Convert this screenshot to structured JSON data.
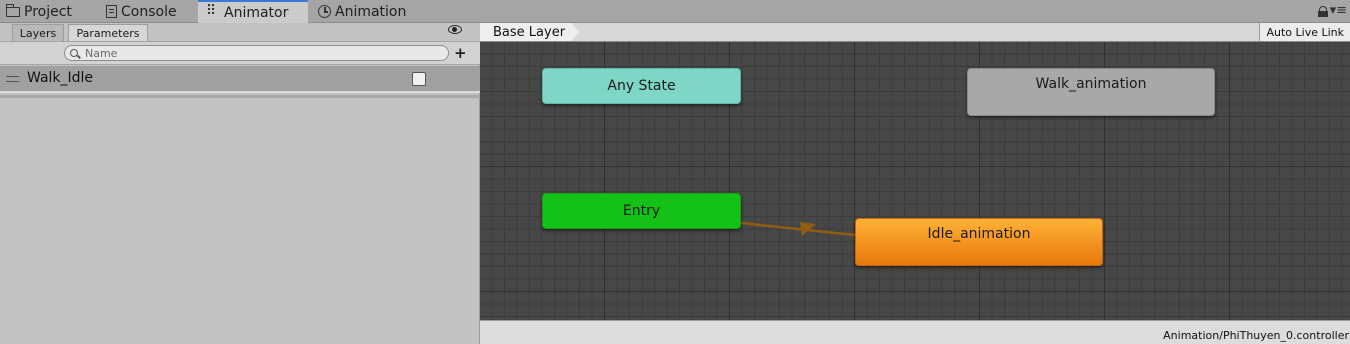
{
  "tabs": {
    "project": "Project",
    "console": "Console",
    "animator": "Animator",
    "animation": "Animation"
  },
  "menu_dots": "▾≡",
  "left_panel": {
    "layers_tab": "Layers",
    "parameters_tab": "Parameters",
    "search_placeholder": "Name",
    "add_button": "+",
    "parameters": [
      {
        "name": "Walk_Idle",
        "type": "bool",
        "value": false
      }
    ]
  },
  "graph": {
    "breadcrumb": "Base Layer",
    "auto_live_link": "Auto Live Link",
    "states": {
      "any_state": "Any State",
      "walk": "Walk_animation",
      "entry": "Entry",
      "idle": "Idle_animation"
    },
    "colors": {
      "any_state": "#7fd6c6",
      "entry": "#13c117",
      "default_state": "#ff9c1f",
      "state": "#a8a8a8",
      "transition": "#8f5e10"
    },
    "status_path": "Animation/PhiThuyen_0.controller"
  }
}
